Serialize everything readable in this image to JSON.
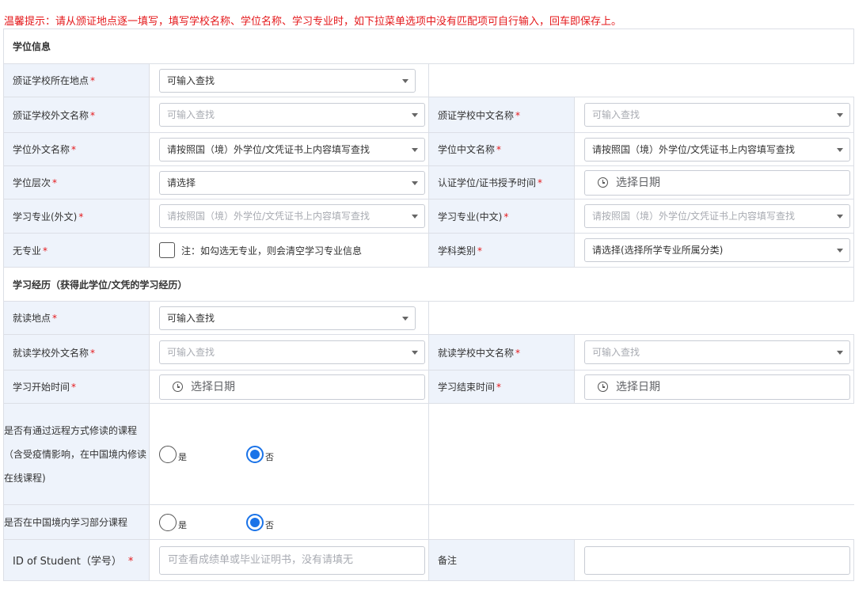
{
  "tip": "温馨提示：请从颁证地点逐一填写，填写学校名称、学位名称、学习专业时，如下拉菜单选项中没有匹配项可自行输入，回车即保存上。",
  "degree_section": {
    "title": "学位信息",
    "school_location": {
      "label": "颁证学校所在地点",
      "value": "可输入查找"
    },
    "school_foreign_name": {
      "label": "颁证学校外文名称",
      "placeholder": "可输入查找"
    },
    "school_chinese_name": {
      "label": "颁证学校中文名称",
      "placeholder": "可输入查找"
    },
    "degree_foreign_name": {
      "label": "学位外文名称",
      "value": "请按照国（境）外学位/文凭证书上内容填写查找"
    },
    "degree_chinese_name": {
      "label": "学位中文名称",
      "value": "请按照国（境）外学位/文凭证书上内容填写查找"
    },
    "degree_level": {
      "label": "学位层次",
      "value": "请选择"
    },
    "award_date": {
      "label": "认证学位/证书授予时间",
      "placeholder": "选择日期"
    },
    "major_foreign": {
      "label": "学习专业(外文)",
      "placeholder": "请按照国（境）外学位/文凭证书上内容填写查找"
    },
    "major_chinese": {
      "label": "学习专业(中文)",
      "placeholder": "请按照国（境）外学位/文凭证书上内容填写查找"
    },
    "no_major": {
      "label": "无专业",
      "note": "注：如勾选无专业，则会清空学习专业信息"
    },
    "discipline": {
      "label": "学科类别",
      "value": "请选择(选择所学专业所属分类)"
    }
  },
  "study_section": {
    "title": "学习经历（获得此学位/文凭的学习经历）",
    "location": {
      "label": "就读地点",
      "value": "可输入查找"
    },
    "school_foreign_name": {
      "label": "就读学校外文名称",
      "placeholder": "可输入查找"
    },
    "school_chinese_name": {
      "label": "就读学校中文名称",
      "placeholder": "可输入查找"
    },
    "start_date": {
      "label": "学习开始时间",
      "placeholder": "选择日期"
    },
    "end_date": {
      "label": "学习结束时间",
      "placeholder": "选择日期"
    },
    "remote_courses": {
      "label": "是否有通过远程方式修读的课程（含受疫情影响，在中国境内修读在线课程)",
      "yes": "是",
      "no": "否",
      "selected": "否"
    },
    "partial_in_china": {
      "label": "是否在中国境内学习部分课程",
      "yes": "是",
      "no": "否",
      "selected": "否"
    },
    "student_id": {
      "label": "ID of Student（学号）",
      "placeholder": "可查看成绩单或毕业证明书，没有请填无"
    },
    "remarks": {
      "label": "备注",
      "value": ""
    }
  },
  "required_mark": "*"
}
